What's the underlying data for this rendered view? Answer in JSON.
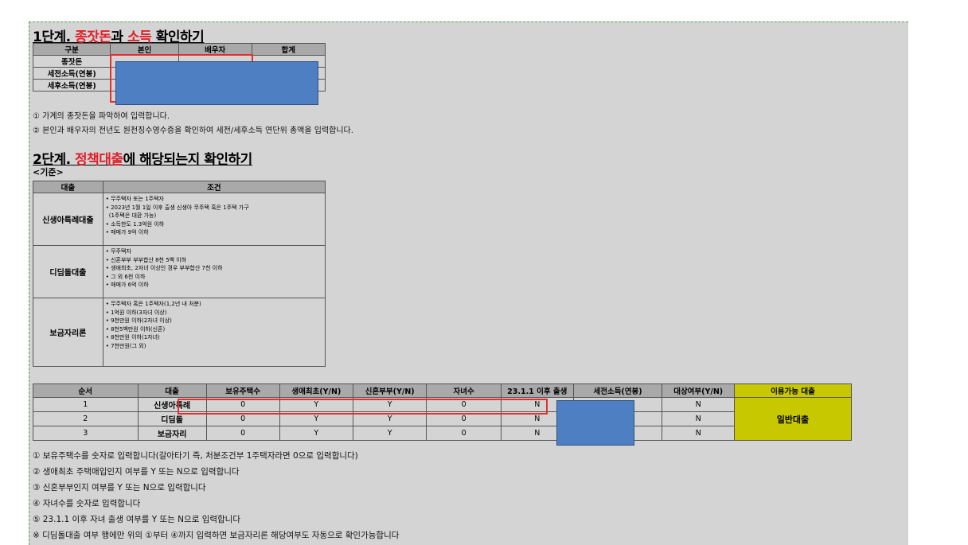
{
  "step1": {
    "title_num": "1단계.",
    "title_red1": "종잣돈",
    "title_mid": "과",
    "title_red2": "소득",
    "title_end": "확인하기",
    "headers": [
      "구분",
      "본인",
      "배우자",
      "합계"
    ],
    "rows": [
      "종잣돈",
      "세전소득(연봉)",
      "세후소득(연봉)"
    ],
    "notes": [
      "① 가계의 종잣돈을 파악하여 입력합니다.",
      "② 본인과 배우자의 전년도 원천징수영수증을 확인하여 세전/세후소득 연단위 총액을 입력합니다."
    ]
  },
  "step2": {
    "title_num": "2단계.",
    "title_red": "정책대출",
    "title_end": "에 해당되는지 확인하기",
    "criteria_label": "<기준>",
    "criteria_headers": [
      "대출",
      "조건"
    ],
    "criteria": [
      {
        "name": "신생아특례대출",
        "conditions": [
          "• 무주택자 또는 1주택자",
          "• 2023년 1월 1일 이후 출생 신생아 무주택 혹은 1주택 가구",
          "  (1주택은 대환 가능)",
          "• 소득한도 1.3억원 이하",
          "• 매매가 9억 이하"
        ]
      },
      {
        "name": "디딤돌대출",
        "conditions": [
          "• 무주택자",
          "• 신혼부부 부부합산 8천 5백 이하",
          "• 생애최초, 2자녀 이상인 경우 부부합산 7천 이하",
          "• 그 외 6천 이하",
          "• 매매가 6억 이하"
        ]
      },
      {
        "name": "보금자리론",
        "conditions": [
          "• 무주택자 혹은 1주택자(1,2년 내 처분)",
          "• 1억원 이하(3자녀 이상)",
          "• 9천만원 이하(2자녀 이상)",
          "• 8천5백만원 이하(신혼)",
          "• 8천만원 이하(1자녀)",
          "• 7천만원(그 외)"
        ]
      }
    ],
    "check_headers": [
      "순서",
      "대출",
      "보유주택수",
      "생애최초(Y/N)",
      "신혼부부(Y/N)",
      "자녀수",
      "23.1.1 이후 출생",
      "세전소득(연봉)",
      "대상여부(Y/N)",
      "이용가능 대출"
    ],
    "check_rows": [
      {
        "no": "1",
        "loan": "신생아특례",
        "houses": "0",
        "first": "Y",
        "newlywed": "Y",
        "children": "0",
        "born": "N",
        "eligible": "N"
      },
      {
        "no": "2",
        "loan": "디딤돌",
        "houses": "0",
        "first": "Y",
        "newlywed": "Y",
        "children": "0",
        "born": "N",
        "eligible": "N"
      },
      {
        "no": "3",
        "loan": "보금자리",
        "houses": "0",
        "first": "Y",
        "newlywed": "Y",
        "children": "0",
        "born": "N",
        "eligible": "N"
      }
    ],
    "result": "일반대출",
    "notes": [
      "① 보유주택수를 숫자로 입력합니다(갈아타기 즉, 처분조건부 1주택자라면 0으로 입력합니다)",
      "② 생애최초 주택매입인지 여부를 Y 또는 N으로 입력합니다",
      "③ 신혼부부인지 여부를 Y 또는 N으로 입력합니다",
      "④ 자녀수를 숫자로 입력합니다",
      "⑤ 23.1.1 이후 자녀 출생 여부를 Y 또는 N으로 입력합니다",
      "※ 디딤돌대출 여부 행에만 위의 ①부터 ④까지 입력하면 보금자리론 해당여부도 자동으로 확인가능합니다"
    ]
  },
  "colors": {
    "blue_fill": "#4f7fc3",
    "header_gray": "#a9a9a9",
    "result_yellow": "#c8c800",
    "accent_red": "#e0202a"
  }
}
